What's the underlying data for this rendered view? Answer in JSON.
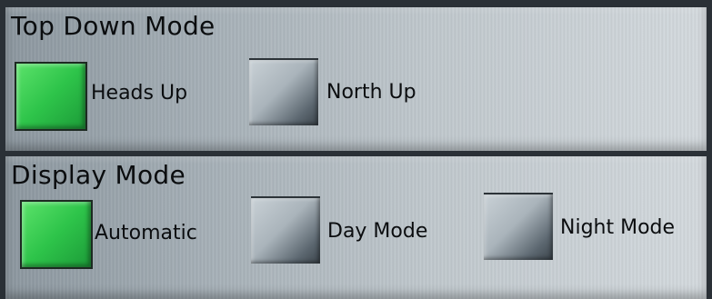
{
  "top_down_mode": {
    "title": "Top Down Mode",
    "options": [
      {
        "label": "Heads Up",
        "selected": true
      },
      {
        "label": "North Up",
        "selected": false
      }
    ]
  },
  "display_mode": {
    "title": "Display Mode",
    "options": [
      {
        "label": "Automatic",
        "selected": true
      },
      {
        "label": "Day Mode",
        "selected": false
      },
      {
        "label": "Night Mode",
        "selected": false
      }
    ]
  },
  "colors": {
    "selected_green": "#2ec44a"
  }
}
